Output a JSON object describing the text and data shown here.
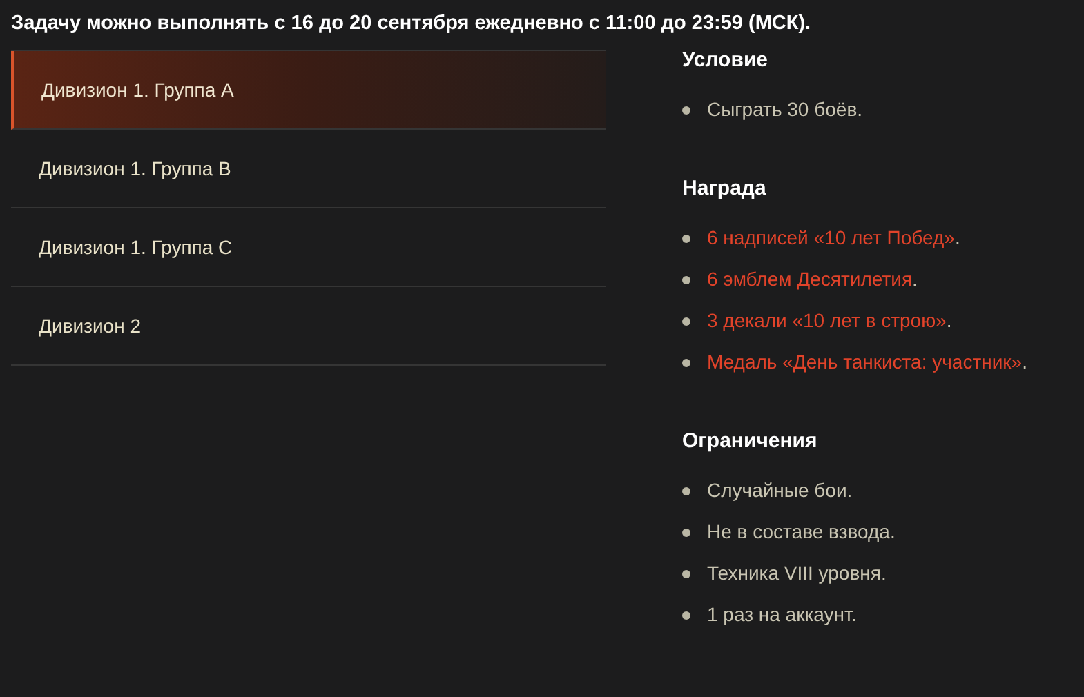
{
  "notice": "Задачу можно выполнять с 16 до 20 сентября ежедневно с 11:00 до 23:59 (МСК).",
  "tabs": [
    {
      "label": "Дивизион 1. Группа А",
      "selected": true
    },
    {
      "label": "Дивизион 1. Группа B",
      "selected": false
    },
    {
      "label": "Дивизион 1. Группа C",
      "selected": false
    },
    {
      "label": "Дивизион 2",
      "selected": false
    }
  ],
  "sections": [
    {
      "title": "Условие",
      "items": [
        {
          "kind": "plain",
          "text": "Сыграть 30 боёв."
        }
      ]
    },
    {
      "title": "Награда",
      "items": [
        {
          "kind": "link",
          "text": "6 надписей «10 лет Побед»",
          "tail": "."
        },
        {
          "kind": "link",
          "text": "6 эмблем Десятилетия",
          "tail": "."
        },
        {
          "kind": "link",
          "text": "3 декали «10 лет в строю»",
          "tail": "."
        },
        {
          "kind": "link",
          "text": "Медаль «День танкиста: участник»",
          "tail": "."
        }
      ]
    },
    {
      "title": "Ограничения",
      "items": [
        {
          "kind": "plain",
          "text": "Случайные бои."
        },
        {
          "kind": "plain",
          "text": "Не в составе взвода."
        },
        {
          "kind": "plain",
          "text": "Техника VIII уровня."
        },
        {
          "kind": "plain",
          "text": "1 раз на аккаунт."
        }
      ]
    }
  ]
}
